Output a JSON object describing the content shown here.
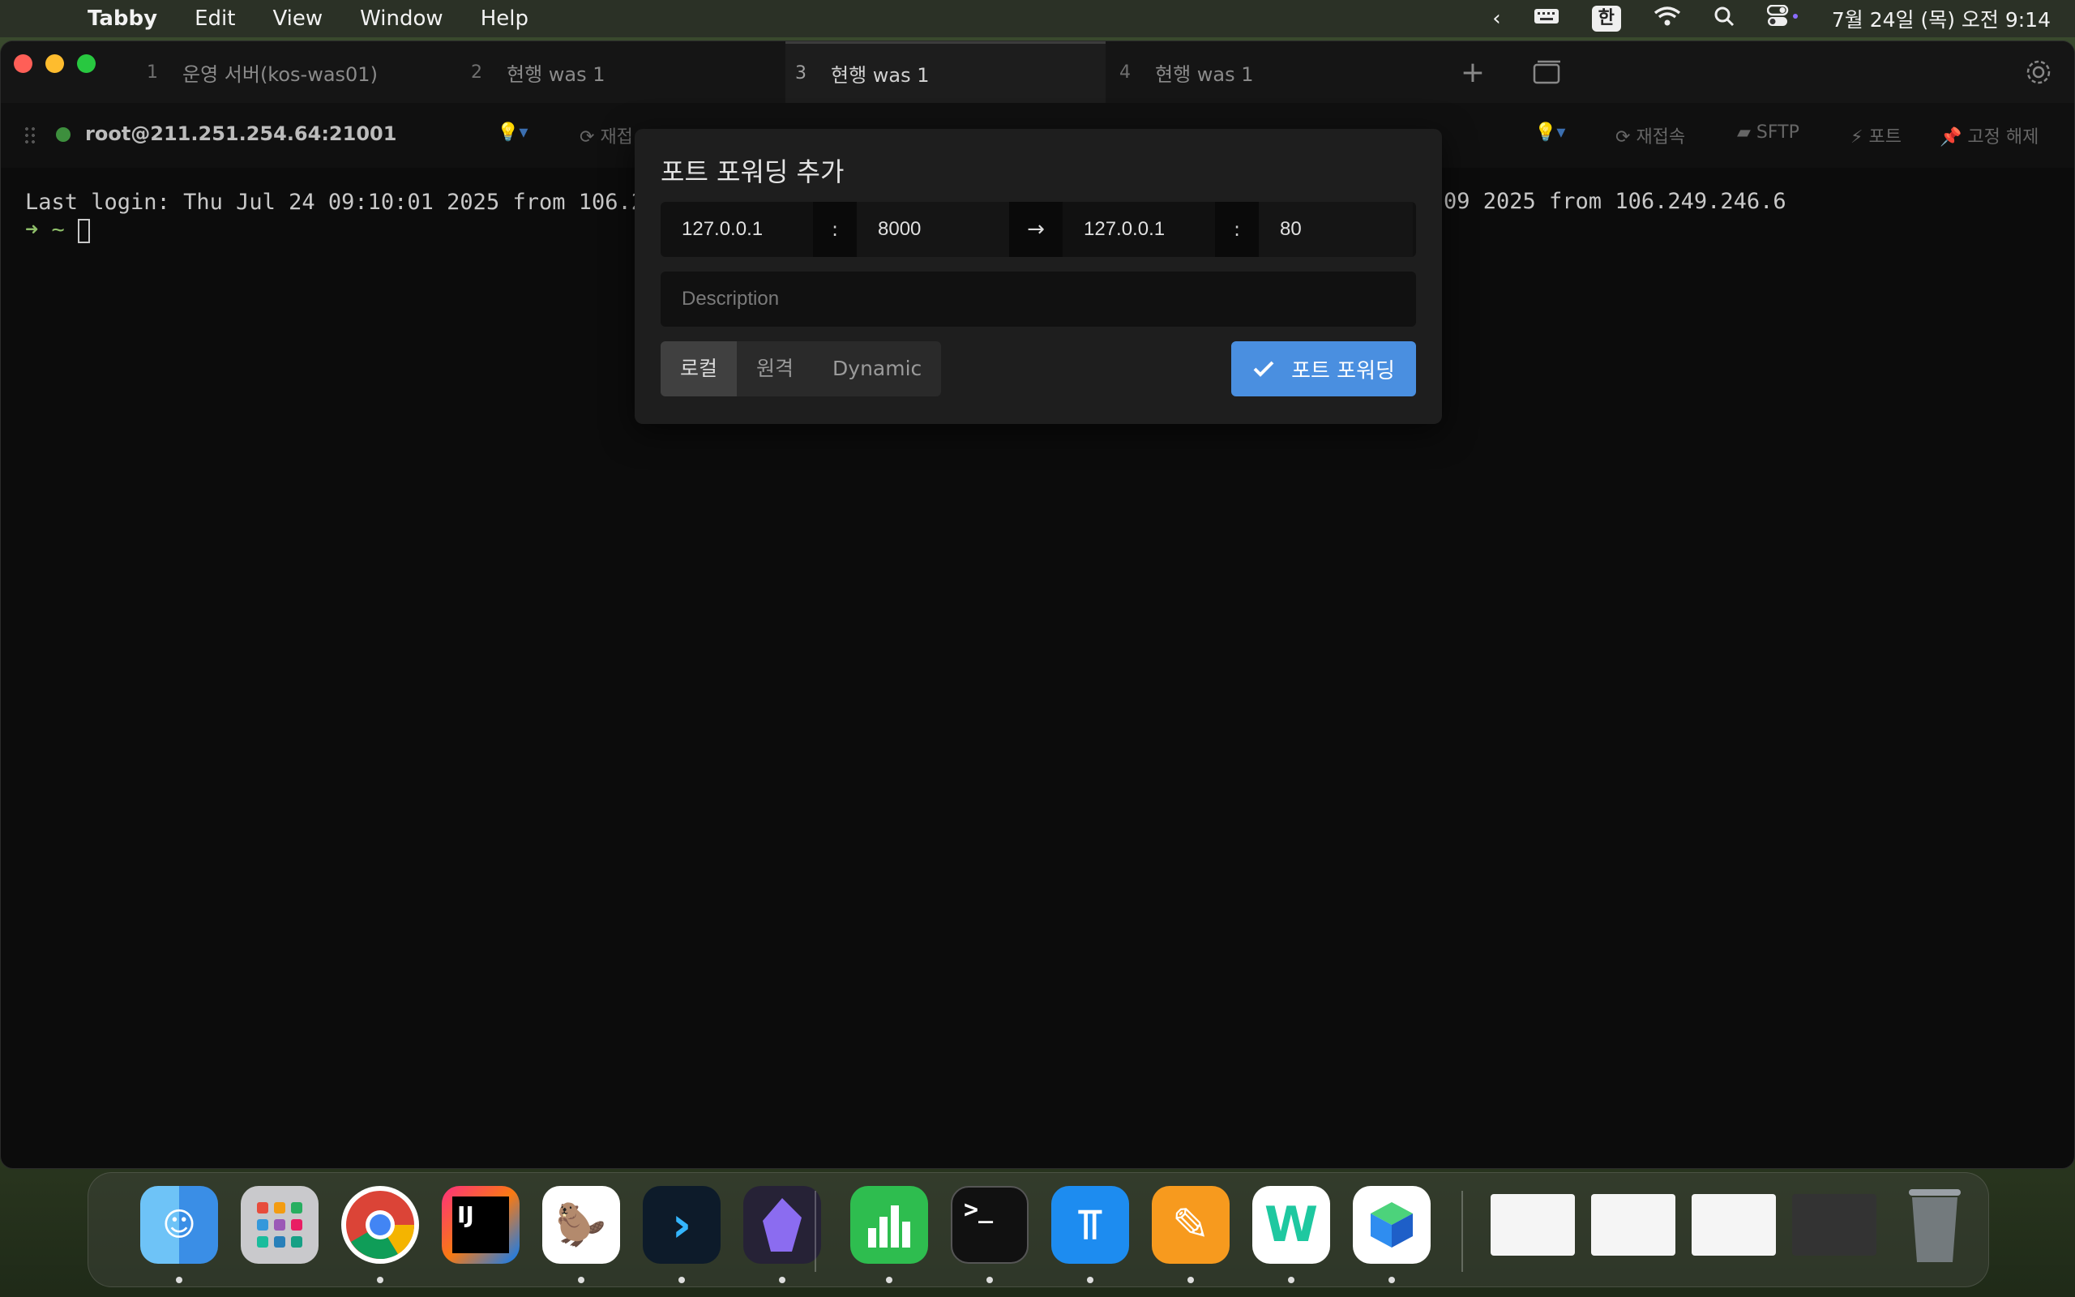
{
  "menubar": {
    "app_name": "Tabby",
    "items": [
      "Edit",
      "View",
      "Window",
      "Help"
    ],
    "ime": "한",
    "clock": "7월 24일 (목) 오전 9:14"
  },
  "tabs": [
    {
      "num": "1",
      "label": "운영 서버(kos-was01)"
    },
    {
      "num": "2",
      "label": "현행 was 1"
    },
    {
      "num": "3",
      "label": "현행 was 1"
    },
    {
      "num": "4",
      "label": "현행 was 1"
    }
  ],
  "toolbar": {
    "host": "root@211.251.254.64:21001",
    "reconnect_partial": "재접",
    "reconnect": "재접속",
    "sftp": "SFTP",
    "ports": "포트",
    "unpin": "고정 해제"
  },
  "terminal": {
    "line1": "Last login: Thu Jul 24 09:10:01 2025 from 106.2",
    "prompt": "➜  ~",
    "line1_right": "09 2025 from 106.249.246.6"
  },
  "dialog": {
    "title": "포트 포워딩 추가",
    "local_host": "127.0.0.1",
    "sep": ":",
    "local_port": "8000",
    "arrow": "→",
    "remote_host": "127.0.0.1",
    "remote_port": "80",
    "description_placeholder": "Description",
    "modes": [
      "로컬",
      "원격",
      "Dynamic"
    ],
    "confirm": "포트 포워딩",
    "accent": "#4a8fe0"
  },
  "dock": {
    "apps": [
      "Finder",
      "Launchpad",
      "Chrome",
      "IntelliJ IDEA CE",
      "DBeaver",
      "Tabby",
      "Obsidian",
      "Numbers",
      "Terminal",
      "Keynote",
      "Pages",
      "Naver Whale",
      "Naver Works"
    ]
  }
}
